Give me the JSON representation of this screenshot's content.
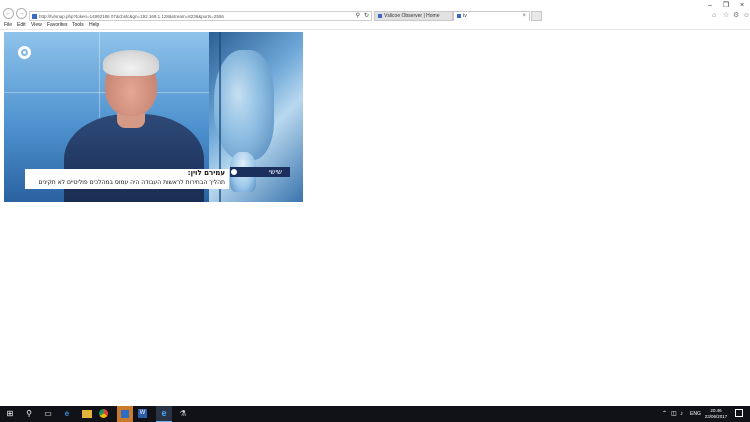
{
  "browser": {
    "address_url": "http://tv/snap.php?token=14992186 07&cbstc&gn=192.168.1.128&stream=8236&ports=2556",
    "tabs": [
      {
        "label": "Vslicoe Observer | Home"
      },
      {
        "label": "tv"
      }
    ],
    "menu": [
      "File",
      "Edit",
      "View",
      "Favorites",
      "Tools",
      "Help"
    ]
  },
  "video": {
    "tag": "שישי",
    "speaker_name": "עמירם לוין:",
    "quote": "תהליך הבחירות לראשות העבודה היה עמוס במהלכים פוליטיים לא תקינים"
  },
  "taskbar": {
    "language": "ENG",
    "time": "20:46",
    "date": "23/06/2017"
  }
}
